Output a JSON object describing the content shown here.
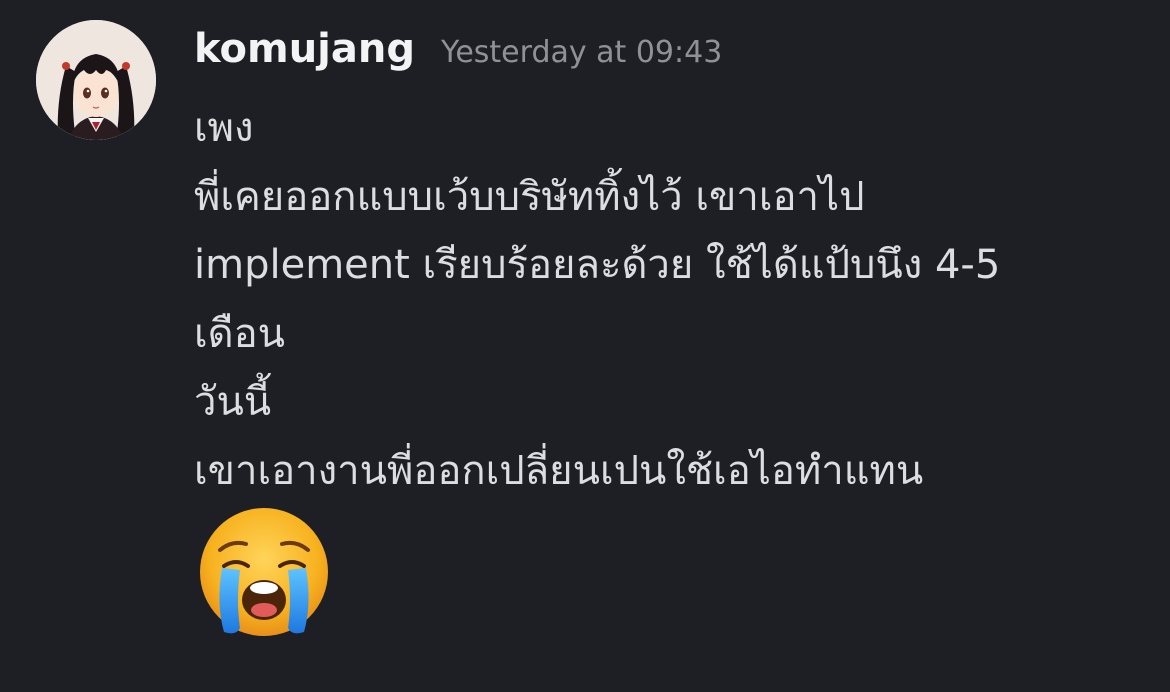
{
  "message": {
    "author": "komujang",
    "timestamp": "Yesterday at 09:43",
    "lines": [
      "เพง",
      "พี่เคยออกแบบเว้บบริษัททิ้งไว้ เขาเอาไป",
      "implement เรียบร้อยละด้วย ใช้ได้แป้บนึง 4-5",
      "เดือน",
      "วันนี้",
      "เขาเอางานพี่ออกเปลี่ยนเปนใช้เอไอทำแทน"
    ],
    "reaction_emoji": "loudly-crying-face-icon"
  },
  "colors": {
    "background": "#1e1f24",
    "username": "#f2f3f5",
    "timestamp": "#8e9297",
    "text": "#dcdde1"
  }
}
